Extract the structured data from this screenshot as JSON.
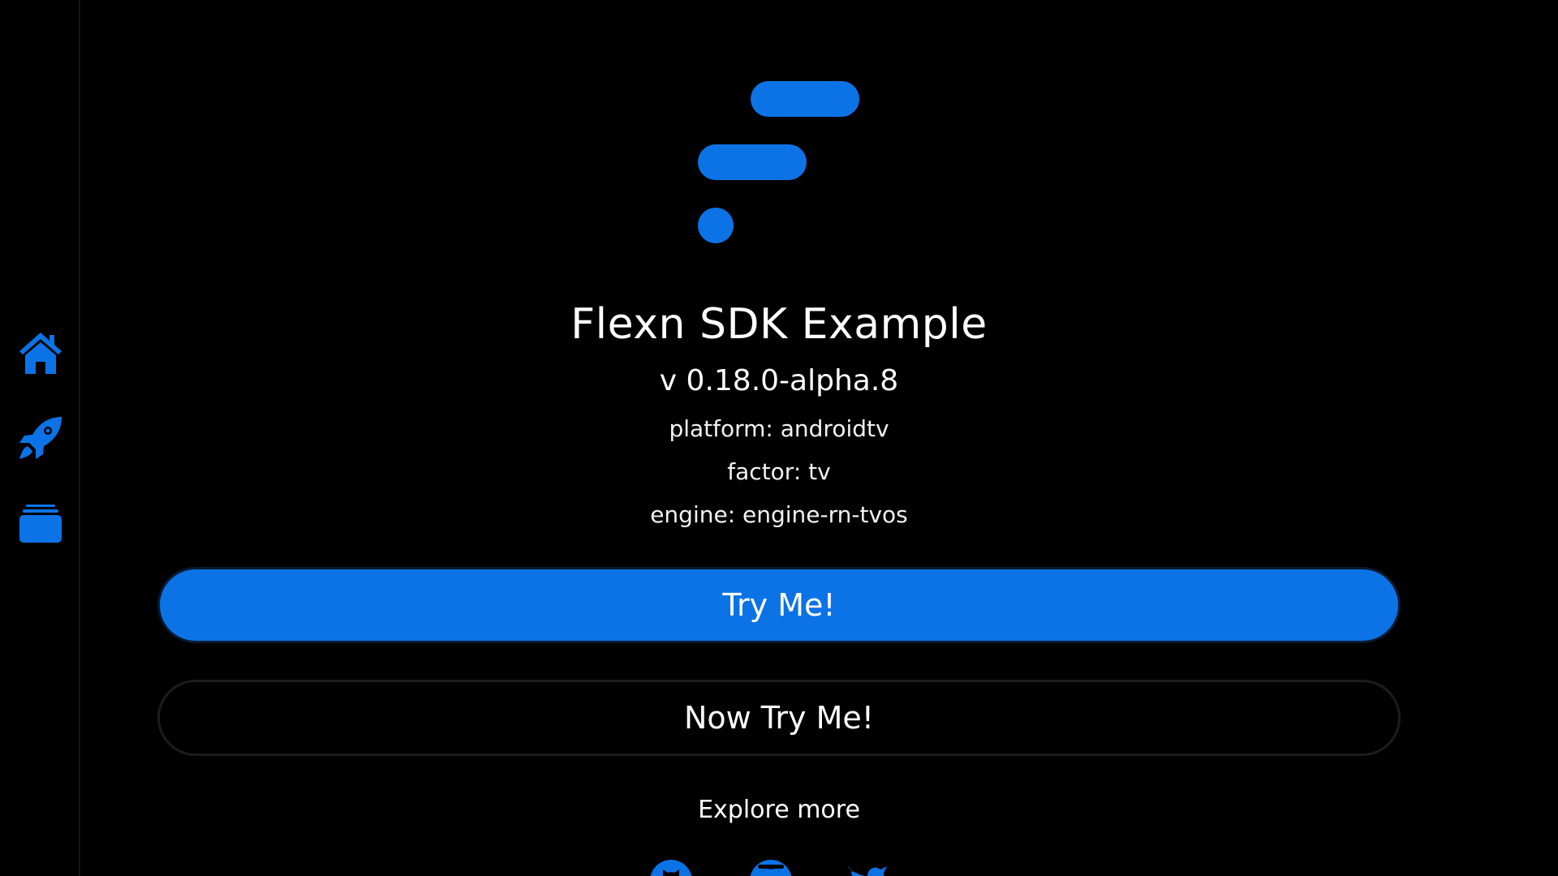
{
  "app": {
    "title": "Flexn SDK Example",
    "version": "v 0.18.0-alpha.8",
    "platform_text": "platform: androidtv",
    "factor_text": "factor: tv",
    "engine_text": "engine: engine-rn-tvos"
  },
  "sidebar": {
    "items": [
      {
        "icon": "home-icon"
      },
      {
        "icon": "rocket-icon"
      },
      {
        "icon": "archive-icon"
      }
    ]
  },
  "buttons": {
    "try_label": "Try Me!",
    "now_try_label": "Now Try Me!"
  },
  "explore": {
    "label": "Explore more",
    "links": [
      {
        "icon": "github-icon"
      },
      {
        "icon": "discord-icon"
      },
      {
        "icon": "twitter-icon"
      }
    ]
  },
  "colors": {
    "accent": "#0c73e6",
    "background": "#000000",
    "text": "#ffffff"
  }
}
